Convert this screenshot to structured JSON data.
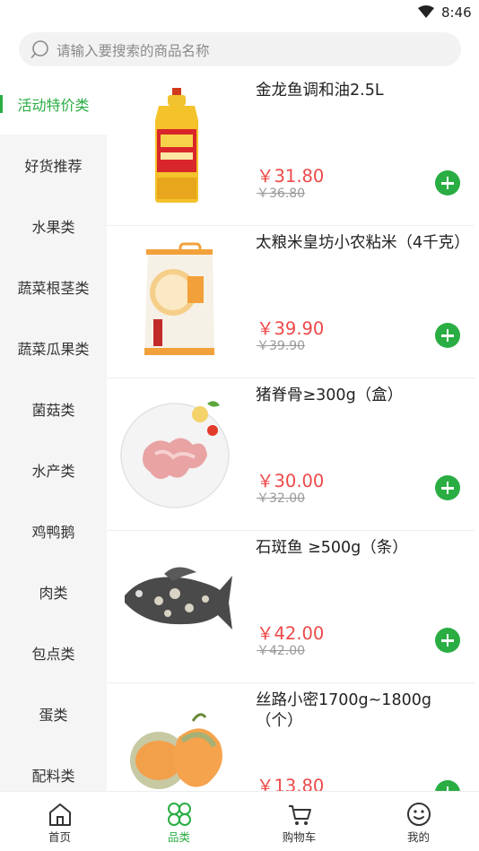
{
  "status_bar": {
    "time": "8:46"
  },
  "search": {
    "placeholder": "请输入要搜索的商品名称"
  },
  "sidebar": {
    "items": [
      {
        "label": "活动特价类",
        "active": true
      },
      {
        "label": "好货推荐"
      },
      {
        "label": "水果类"
      },
      {
        "label": "蔬菜根茎类"
      },
      {
        "label": "蔬菜瓜果类"
      },
      {
        "label": "菌菇类"
      },
      {
        "label": "水产类"
      },
      {
        "label": "鸡鸭鹅"
      },
      {
        "label": "肉类"
      },
      {
        "label": "包点类"
      },
      {
        "label": "蛋类"
      },
      {
        "label": "配料类"
      }
    ]
  },
  "products": [
    {
      "name": "金龙鱼调和油2.5L",
      "price": "￥31.80",
      "original_price": "￥36.80",
      "image_icon": "cooking-oil-bottle"
    },
    {
      "name": "太粮米皇坊小农粘米（4千克）",
      "price": "￥39.90",
      "original_price": "￥39.90",
      "image_icon": "rice-bag"
    },
    {
      "name": "猪脊骨≥300g（盒）",
      "price": "￥30.00",
      "original_price": "￥32.00",
      "image_icon": "pork-spine-plate"
    },
    {
      "name": "石斑鱼 ≥500g（条）",
      "price": "￥42.00",
      "original_price": "￥42.00",
      "image_icon": "grouper-fish"
    },
    {
      "name": "丝路小密1700g~1800g（个）",
      "price": "￥13.80",
      "original_price": "",
      "image_icon": "cantaloupe-melon"
    }
  ],
  "tabbar": {
    "items": [
      {
        "label": "首页",
        "icon": "home-icon"
      },
      {
        "label": "品类",
        "icon": "category-icon",
        "active": true
      },
      {
        "label": "购物车",
        "icon": "cart-icon"
      },
      {
        "label": "我的",
        "icon": "profile-icon"
      }
    ]
  },
  "colors": {
    "accent": "#2aad43",
    "price": "#ee4949",
    "sidebar_bg": "#f5f5f5",
    "search_bg": "#f2f2f2"
  }
}
